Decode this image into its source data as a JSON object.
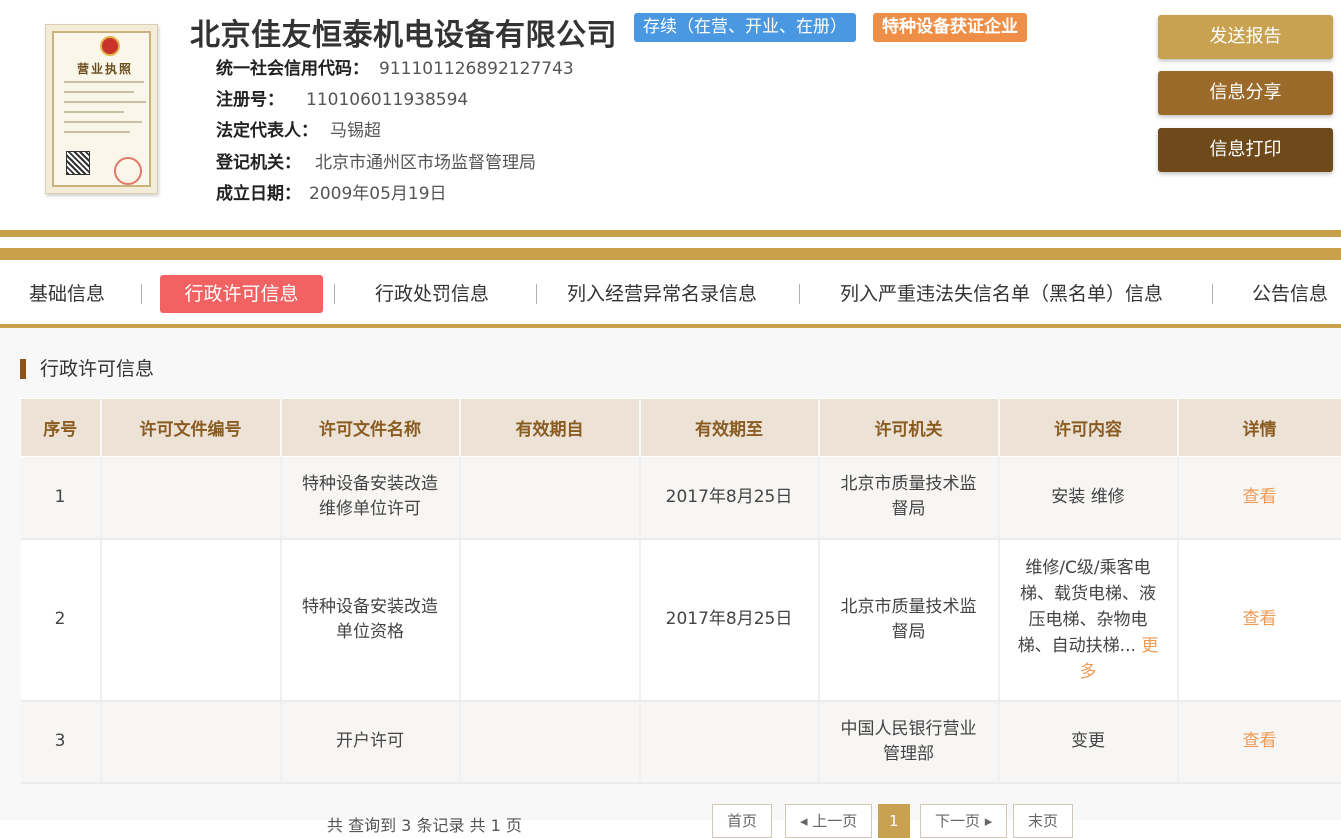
{
  "company": {
    "name": "北京佳友恒泰机电设备有限公司",
    "status_badge": "存续（在营、开业、在册）",
    "special_badge": "特种设备获证企业",
    "license_image_text": "营业执照"
  },
  "info": [
    {
      "label": "统一社会信用代码：",
      "value": "911101126892127743"
    },
    {
      "label": "注册号：",
      "value": "110106011938594"
    },
    {
      "label": "法定代表人：",
      "value": "马锡超"
    },
    {
      "label": "登记机关：",
      "value": "北京市通州区市场监督管理局"
    },
    {
      "label": "成立日期：",
      "value": "2009年05月19日"
    }
  ],
  "actions": {
    "send": "发送报告",
    "share": "信息分享",
    "print": "信息打印"
  },
  "tabs": [
    {
      "label": "基础信息"
    },
    {
      "label": "行政许可信息"
    },
    {
      "label": "行政处罚信息"
    },
    {
      "label": "列入经营异常名录信息"
    },
    {
      "label": "列入严重违法失信名单（黑名单）信息"
    },
    {
      "label": "公告信息"
    }
  ],
  "section_title": "行政许可信息",
  "table": {
    "headers": [
      "序号",
      "许可文件编号",
      "许可文件名称",
      "有效期自",
      "有效期至",
      "许可机关",
      "许可内容",
      "详情"
    ],
    "rows": [
      {
        "no": "1",
        "doc_no": "",
        "doc_name": "特种设备安装改造维修单位许可",
        "valid_from": "",
        "valid_to": "2017年8月25日",
        "authority": "北京市质量技术监督局",
        "content": "安装 维修",
        "more": "",
        "detail": "查看"
      },
      {
        "no": "2",
        "doc_no": "",
        "doc_name": "特种设备安装改造单位资格",
        "valid_from": "",
        "valid_to": "2017年8月25日",
        "authority": "北京市质量技术监督局",
        "content": "维修/C级/乘客电梯、载货电梯、液压电梯、杂物电梯、自动扶梯...",
        "more": "更多",
        "detail": "查看"
      },
      {
        "no": "3",
        "doc_no": "",
        "doc_name": "开户许可",
        "valid_from": "",
        "valid_to": "",
        "authority": "中国人民银行营业管理部",
        "content": "变更",
        "more": "",
        "detail": "查看"
      }
    ]
  },
  "pager": {
    "summary": "共 查询到 3 条记录 共 1 页",
    "first": "首页",
    "prev": "◂ 上一页",
    "current": "1",
    "next": "下一页 ▸",
    "last": "末页"
  },
  "colors": {
    "gold": "#c9a04a",
    "status_blue": "#4a98e2",
    "special_orange": "#ef8f47",
    "active_tab": "#f36263",
    "link_orange": "#ef9a55"
  }
}
